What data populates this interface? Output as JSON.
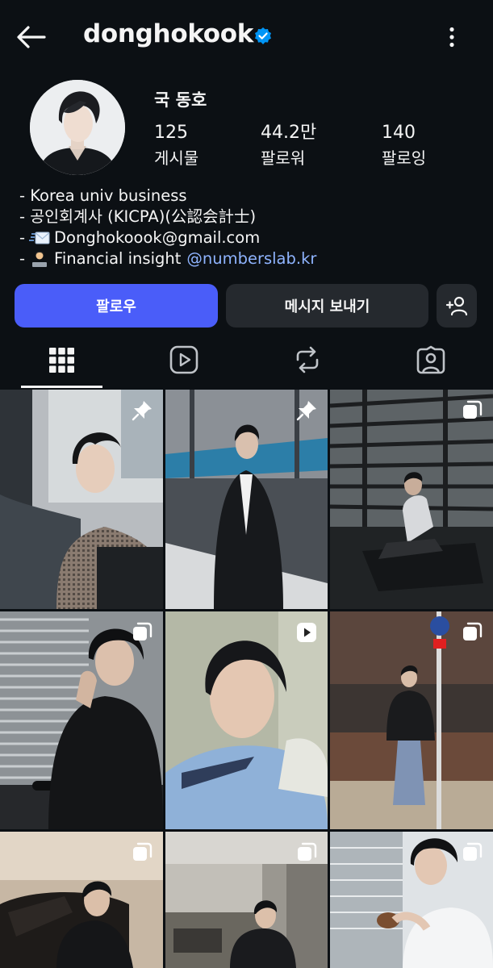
{
  "header": {
    "username": "donghokook",
    "icons": [
      "back-arrow-icon",
      "verified-badge-icon",
      "more-vertical-icon"
    ]
  },
  "profile": {
    "display_name": "국 동호",
    "stats": [
      {
        "value": "125",
        "label": "게시물"
      },
      {
        "value": "44.2만",
        "label": "팔로워"
      },
      {
        "value": "140",
        "label": "팔로잉"
      }
    ],
    "bio": {
      "line1": "- Korea univ business",
      "line2": "- 공인회계사 (KICPA)(公認会計士)",
      "line3_prefix": "-",
      "line3_text": "Donghokoook@gmail.com",
      "line4_prefix": "-",
      "line4_text": "Financial insight",
      "line4_link": "@numberslab.kr"
    }
  },
  "actions": {
    "follow_label": "팔로우",
    "message_label": "메시지 보내기",
    "add_icon": "add-person-icon"
  },
  "tabs": [
    "grid-icon",
    "reels-icon",
    "reposts-icon",
    "tagged-icon"
  ],
  "grid": {
    "posts": [
      {
        "badge": "pin"
      },
      {
        "badge": "pin"
      },
      {
        "badge": "carousel"
      },
      {
        "badge": "carousel"
      },
      {
        "badge": "reel"
      },
      {
        "badge": "carousel"
      },
      {
        "badge": "carousel"
      },
      {
        "badge": "carousel"
      },
      {
        "badge": "carousel"
      }
    ]
  },
  "colors": {
    "background": "#0c1014",
    "follow_button": "#4a5df9",
    "secondary_button": "#25292e",
    "link": "#8fb4ff",
    "verified": "#0095f6"
  }
}
